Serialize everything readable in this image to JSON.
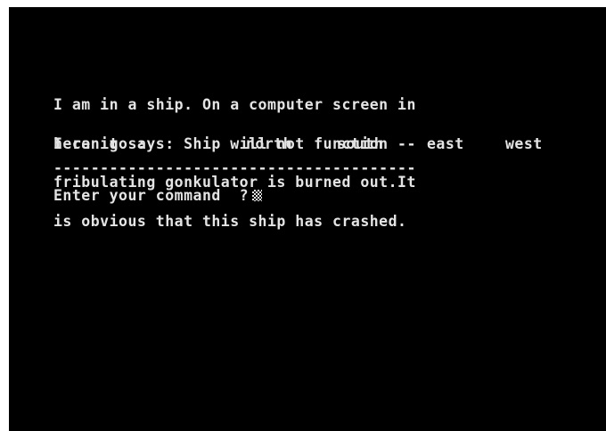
{
  "description": {
    "lines": [
      "I am in a ship. On a computer screen in",
      "here it says: Ship will not function --",
      "fribulating gonkulator is burned out.It",
      "is obvious that this ship has crashed."
    ]
  },
  "exits": {
    "label": "I can go :",
    "directions": [
      "north",
      "south",
      "east",
      "west"
    ]
  },
  "separator": "---------------------------------------",
  "command": {
    "prompt": "Enter your command  ?"
  }
}
